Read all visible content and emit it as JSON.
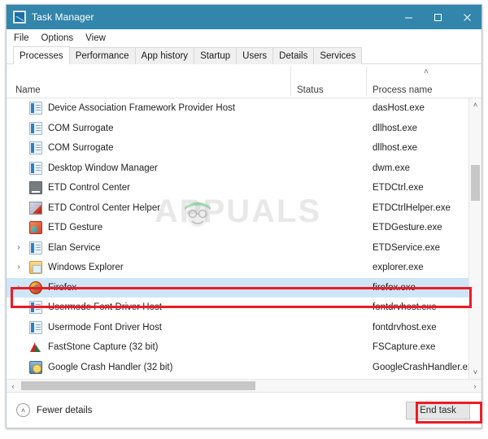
{
  "window": {
    "title": "Task Manager",
    "icon": "task-manager-icon",
    "titlebar_color": "#3285ab",
    "controls": {
      "minimize": "—",
      "maximize": "□",
      "close": "✕"
    }
  },
  "menu": {
    "items": [
      "File",
      "Options",
      "View"
    ]
  },
  "tabs": [
    {
      "label": "Processes",
      "active": true
    },
    {
      "label": "Performance",
      "active": false
    },
    {
      "label": "App history",
      "active": false
    },
    {
      "label": "Startup",
      "active": false
    },
    {
      "label": "Users",
      "active": false
    },
    {
      "label": "Details",
      "active": false
    },
    {
      "label": "Services",
      "active": false
    }
  ],
  "table": {
    "sort_indicator": "˄",
    "sort_column": "Process name",
    "columns": [
      "Name",
      "Status",
      "Process name"
    ],
    "rows": [
      {
        "expander": "",
        "icon": "window-icon",
        "name": "Device Association Framework Provider Host",
        "status": "",
        "process": "dasHost.exe",
        "selected": false
      },
      {
        "expander": "",
        "icon": "window-icon",
        "name": "COM Surrogate",
        "status": "",
        "process": "dllhost.exe",
        "selected": false
      },
      {
        "expander": "",
        "icon": "window-icon",
        "name": "COM Surrogate",
        "status": "",
        "process": "dllhost.exe",
        "selected": false
      },
      {
        "expander": "",
        "icon": "window-icon",
        "name": "Desktop Window Manager",
        "status": "",
        "process": "dwm.exe",
        "selected": false
      },
      {
        "expander": "",
        "icon": "monitor-icon",
        "name": "ETD Control Center",
        "status": "",
        "process": "ETDCtrl.exe",
        "selected": false
      },
      {
        "expander": "",
        "icon": "helper-icon",
        "name": "ETD Control Center Helper",
        "status": "",
        "process": "ETDCtrlHelper.exe",
        "selected": false
      },
      {
        "expander": "",
        "icon": "gesture-icon",
        "name": "ETD Gesture",
        "status": "",
        "process": "ETDGesture.exe",
        "selected": false
      },
      {
        "expander": "›",
        "icon": "window-icon",
        "name": "Elan Service",
        "status": "",
        "process": "ETDService.exe",
        "selected": false
      },
      {
        "expander": "›",
        "icon": "folder-icon",
        "name": "Windows Explorer",
        "status": "",
        "process": "explorer.exe",
        "selected": false
      },
      {
        "expander": "›",
        "icon": "firefox-icon",
        "name": "Firefox",
        "status": "",
        "process": "firefox.exe",
        "selected": true
      },
      {
        "expander": "",
        "icon": "window-icon",
        "name": "Usermode Font Driver Host",
        "status": "",
        "process": "fontdrvhost.exe",
        "selected": false
      },
      {
        "expander": "",
        "icon": "window-icon",
        "name": "Usermode Font Driver Host",
        "status": "",
        "process": "fontdrvhost.exe",
        "selected": false
      },
      {
        "expander": "",
        "icon": "faststone-icon",
        "name": "FastStone Capture (32 bit)",
        "status": "",
        "process": "FSCapture.exe",
        "selected": false
      },
      {
        "expander": "",
        "icon": "crash-icon",
        "name": "Google Crash Handler (32 bit)",
        "status": "",
        "process": "GoogleCrashHandler.exe",
        "selected": false
      }
    ]
  },
  "scrollbars": {
    "vertical": {
      "up_arrow": "˄",
      "down_arrow": "˅"
    },
    "horizontal": {
      "left_arrow": "‹",
      "right_arrow": "›"
    }
  },
  "statusbar": {
    "fewer_details_label": "Fewer details",
    "fewer_details_icon": "˄",
    "end_task_label": "End task"
  },
  "annotations": {
    "highlight_color": "#ec1c24",
    "targets": [
      "firefox-row",
      "end-task-button"
    ]
  },
  "watermark": {
    "text": "APPUALS"
  }
}
